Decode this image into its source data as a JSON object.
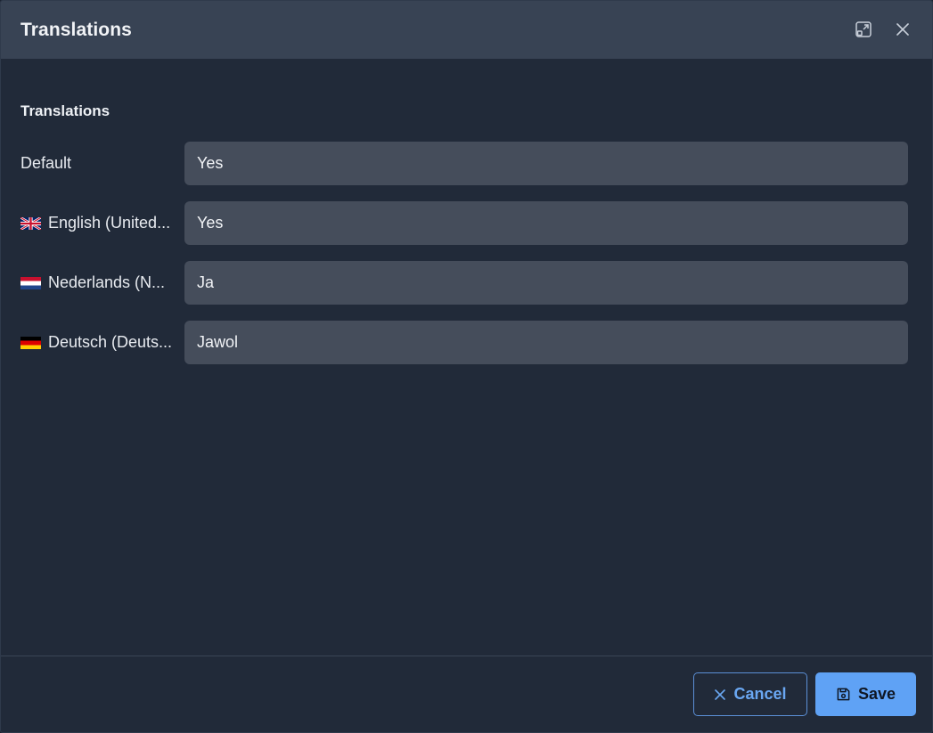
{
  "dialog": {
    "title": "Translations",
    "expand_icon": "expand-icon",
    "close_icon": "close-icon"
  },
  "section": {
    "title": "Translations"
  },
  "rows": [
    {
      "label": "Default",
      "flag": "",
      "value": "Yes"
    },
    {
      "label": "English (United...",
      "flag": "uk-flag-icon",
      "value": "Yes"
    },
    {
      "label": "Nederlands (N...",
      "flag": "nl-flag-icon",
      "value": "Ja"
    },
    {
      "label": "Deutsch (Deuts...",
      "flag": "de-flag-icon",
      "value": "Jawol"
    }
  ],
  "footer": {
    "cancel_label": "Cancel",
    "save_label": "Save",
    "cancel_icon": "x-icon",
    "save_icon": "floppy-disk-icon"
  },
  "colors": {
    "header_bg": "#384354",
    "body_bg": "#212a39",
    "input_bg": "#454d5b",
    "accent": "#5fa2f5"
  }
}
